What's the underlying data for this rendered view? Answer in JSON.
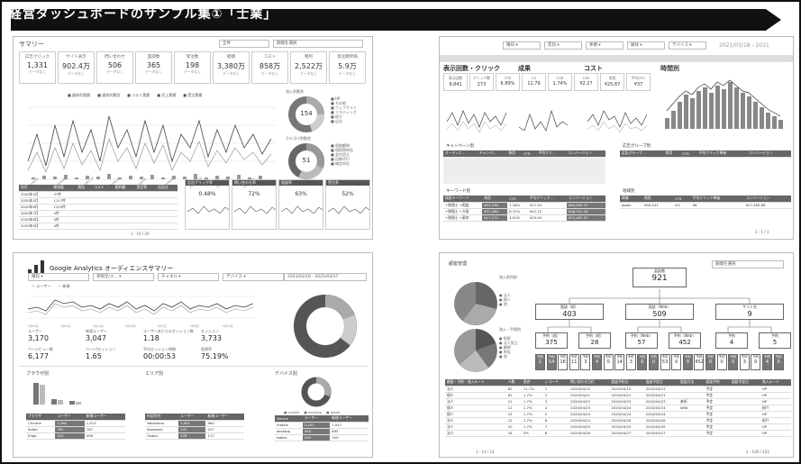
{
  "banner": {
    "title": "経営ダッシュボードのサンプル集①「士業」"
  },
  "p1": {
    "title": "サマリー",
    "filter1": "全件",
    "filter2": "期間を選択",
    "cards": [
      {
        "label": "広告クリック",
        "value": "1,331",
        "sub": "データなし"
      },
      {
        "label": "サイト表示",
        "value": "902.4万",
        "sub": "データなし"
      },
      {
        "label": "問い合わせ",
        "value": "506",
        "sub": "データなし"
      },
      {
        "label": "面談数",
        "value": "365",
        "sub": "データなし"
      },
      {
        "label": "受注数",
        "value": "198",
        "sub": "データなし"
      },
      {
        "label": "総額",
        "value": "3,380万",
        "sub": "データなし"
      },
      {
        "label": "コスト",
        "value": "858万",
        "sub": "データなし"
      },
      {
        "label": "粗利",
        "value": "2,522万",
        "sub": "データなし"
      },
      {
        "label": "受注額単価",
        "value": "5.9万",
        "sub": "データなし"
      }
    ],
    "legend": [
      "媒体別実績",
      "媒体別費用",
      "コスト実績",
      "売上実績",
      "受注実績"
    ],
    "donut1_title": "流入別割合",
    "donut1_value": "154",
    "donut2_title": "カテゴリ別割合",
    "donut2_value": "51",
    "table_headers": [
      "年月",
      "総流量",
      "費用",
      "コスト",
      "粗利額",
      "受注率",
      "広告比"
    ],
    "table_rows": [
      [
        "2020年4月",
        "37件",
        "",
        "",
        "",
        "",
        ""
      ],
      [
        "2020年5月",
        "1117件",
        "",
        "",
        "",
        "",
        ""
      ],
      [
        "2020年6月",
        "1120件",
        "",
        "",
        "",
        "",
        ""
      ],
      [
        "2020年7月",
        "4件",
        "",
        "",
        "",
        "",
        ""
      ],
      [
        "2020年8月",
        "4件",
        "",
        "",
        "",
        "",
        ""
      ],
      [
        "2020年9月",
        "4件",
        "",
        "",
        "",
        "",
        ""
      ]
    ],
    "sub_titles": [
      "広告クリック率",
      "問い合わせ率",
      "面談率",
      "受注率"
    ],
    "sub_vals": [
      "0.48%",
      "72%",
      "63%",
      "52%"
    ],
    "pager": "1 - 10 / 20"
  },
  "p2": {
    "filters": [
      "曜日",
      "年別",
      "季節",
      "媒体",
      "デバイス"
    ],
    "date": "2021/03/18 - 2021",
    "sec_titles": [
      "表示回数・クリック",
      "成果",
      "コスト",
      "時間別"
    ],
    "kpis": [
      {
        "label": "表示回数",
        "value": "9,841"
      },
      {
        "label": "クリック数",
        "value": "273"
      },
      {
        "label": "CTR",
        "value": "6.89%"
      },
      {
        "label": "CV",
        "value": "11.79"
      },
      {
        "label": "CVR",
        "value": "1.74%"
      },
      {
        "label": "CPA",
        "value": "¥2.27"
      },
      {
        "label": "費用",
        "value": "¥25.87"
      },
      {
        "label": "平均CPC",
        "value": "¥37"
      }
    ],
    "campaign_title": "キャンペーン別",
    "campaign_headers": [
      "オーディエ...",
      "キャンペ...",
      "費用",
      "CTR",
      "平均クリ...",
      "コンバージョン"
    ],
    "adgroup_title": "広告グループ別",
    "adgroup_headers": [
      "広告グループ...",
      "費用",
      "CTR",
      "平均クリック単価",
      "コンバージョン"
    ],
    "keyword_title": "キーワード別",
    "keyword_headers": [
      "検索キーワード",
      "費用",
      "CTR",
      "平均クリック...",
      "コンバージョン"
    ],
    "keyword_rows": [
      [
        "+税理士 +相談",
        "¥22,230",
        "7.18%",
        "¥27.44",
        "¥85,452.37"
      ],
      [
        "+税理士 +大阪",
        "¥22,280",
        "8.31%",
        "¥42.12",
        "¥48,702.45"
      ],
      [
        "+税理士 +東京",
        "¥17,172",
        "4.51%",
        "¥25.00",
        "¥23,487.37"
      ]
    ],
    "region_title": "地域別",
    "region_headers": [
      "地域",
      "費用",
      "CTR",
      "平均クリック単価",
      "コンバージョン"
    ],
    "region_rows": [
      [
        "Japan",
        "¥56,101",
        "4%",
        "¥6",
        "¥27,485.88"
      ]
    ],
    "pager": "1 - 1 / 1"
  },
  "p3": {
    "title": "Google Analytics オーディエンスサマリー",
    "filters": [
      "曜日",
      "参照元/メ...",
      "チャネル",
      "デバイス"
    ],
    "date": "2021/02/16 - 2021/03/17",
    "legend": [
      "ユーザー",
      "新規"
    ],
    "metrics": [
      {
        "label": "ユーザー",
        "value": "3,170"
      },
      {
        "label": "新規ユーザー",
        "value": "3,047"
      },
      {
        "label": "ユーザーあたりのセッション数",
        "value": "1.18"
      },
      {
        "label": "セッション",
        "value": "3,733"
      },
      {
        "label": "ページビュー数",
        "value": "6,177"
      },
      {
        "label": "ページ/セッション",
        "value": "1.65"
      },
      {
        "label": "平均セッション時間",
        "value": "00:00:53"
      },
      {
        "label": "直帰率",
        "value": "75.19%"
      }
    ],
    "browser_title": "ブラウザ別",
    "browser_headers": [
      "ブラウザ",
      "ユーザー",
      "新規ユーザー"
    ],
    "browser_rows": [
      [
        "Chrome",
        "1,982",
        "1,913"
      ],
      [
        "Safari",
        "781",
        "767"
      ],
      [
        "Edge",
        "412",
        "406"
      ]
    ],
    "area_title": "エリア別",
    "area_headers": [
      "市区町村",
      "ユーザー",
      "新規ユーザー"
    ],
    "area_rows": [
      [
        "Yokohama",
        "1,001",
        "964"
      ],
      [
        "Kawasaki",
        "243",
        "237"
      ],
      [
        "Osaka",
        "176",
        "172"
      ]
    ],
    "device_title": "デバイス別",
    "device_headers": [
      "Device",
      "ユーザー",
      "新規ユーザー"
    ],
    "device_rows": [
      [
        "mobile",
        "2,103",
        "2,047"
      ],
      [
        "desktop",
        "958",
        "895"
      ],
      [
        "tablet",
        "109",
        "105"
      ]
    ],
    "donut_legend": [
      "mobile",
      "desktop",
      "tablet"
    ]
  },
  "p4": {
    "title": "顧客管理",
    "filter": "期間を選択",
    "pie1_title": "流入別内訳",
    "pie2_title": "流入・手続別",
    "tree_root": {
      "label": "面談数",
      "value": "921"
    },
    "tree_l2": [
      {
        "label": "面談（紹）",
        "value": "403"
      },
      {
        "label": "面談（Web）",
        "value": "509"
      },
      {
        "label": "サイト名",
        "value": "9"
      }
    ],
    "tree_l3": [
      {
        "label": "予約（紹）",
        "value": "375"
      },
      {
        "label": "予約（紹）",
        "value": "28"
      },
      {
        "label": "予約（Web）",
        "value": "57"
      },
      {
        "label": "予約（Web）",
        "value": "452"
      },
      {
        "label": "予約",
        "value": "4"
      },
      {
        "label": "予約",
        "value": "5"
      }
    ],
    "leaves": [
      "1",
      "54",
      "16",
      "11",
      "3",
      "4",
      "0",
      "14",
      "3",
      "0",
      "0",
      "53",
      "0",
      "0",
      "452",
      "0",
      "0",
      "0",
      "3",
      "0",
      "4",
      "0"
    ],
    "table_headers": [
      "顧客・予約・流入ルート",
      "人数",
      "割合",
      "レコード",
      "問い合わせ日付",
      "面談予約日",
      "面談予定日",
      "面談方法",
      "面談予約",
      "面談予定日",
      "流入ルート"
    ],
    "table_rows": [
      [
        "法人",
        "82",
        "11.7%",
        "1",
        "2020/04/15",
        "2020/04/15",
        "2020/04/17",
        "",
        "予定",
        "",
        "HP"
      ],
      [
        "個人",
        "81",
        "1.7%",
        "2",
        "2020/04/21",
        "2020/04/21",
        "2020/04/21",
        "",
        "予定",
        "",
        "HP"
      ],
      [
        "法人",
        "21",
        "1.7%",
        "3",
        "2020/04/22",
        "2020/04/23",
        "2020/04/23",
        "来所",
        "予定",
        "",
        "HP"
      ],
      [
        "個人",
        "12",
        "1.7%",
        "4",
        "2020/04/23",
        "2020/04/24",
        "2020/04/24",
        "Web",
        "予定",
        "",
        "紹介"
      ],
      [
        "個人",
        "15",
        "1.7%",
        "5",
        "2020/04/24",
        "2020/04/24",
        "2020/04/24",
        "",
        "予定",
        "",
        "HP"
      ],
      [
        "法人",
        "12",
        "1.7%",
        "6",
        "2020/04/24",
        "2020/04/26",
        "2020/04/26",
        "",
        "予定",
        "",
        "紹介"
      ],
      [
        "法人",
        "20",
        "1.7%",
        "7",
        "2020/04/25",
        "2020/04/25",
        "2020/04/25",
        "",
        "予定",
        "",
        "HP"
      ],
      [
        "法人",
        "34",
        "3%",
        "8",
        "2020/04/26",
        "2020/04/27",
        "2020/04/27",
        "",
        "予定",
        "",
        "HP"
      ]
    ],
    "pager1": "1 - 14 / 14",
    "pager2": "1 - 100 / 353"
  }
}
